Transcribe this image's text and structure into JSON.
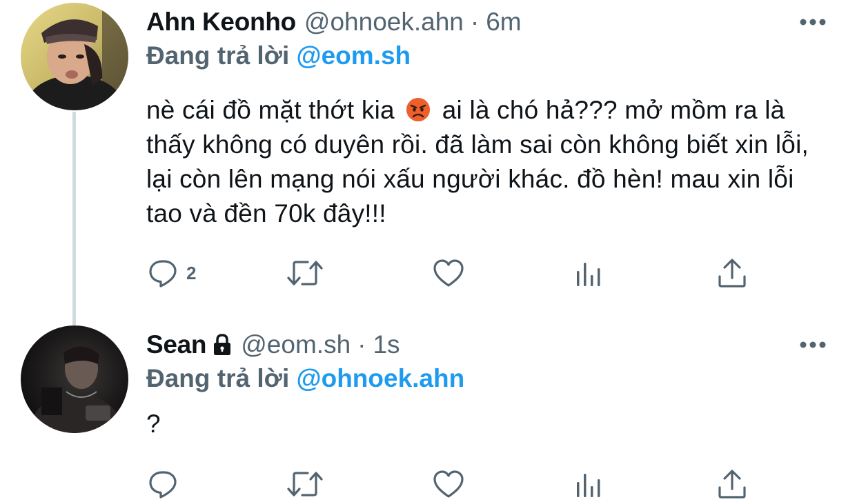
{
  "thread": [
    {
      "display_name": "Ahn Keonho",
      "handle": "@ohnoek.ahn",
      "separator": "·",
      "time": "6m",
      "reply_prefix": "Đang trả lời",
      "reply_mention": "@eom.sh",
      "text_part1": "nè cái đồ mặt thớt kia",
      "emoji": "pouting-face",
      "text_part2": "ai là chó hả??? mở mồm ra là thấy không có duyên rồi. đã làm sai còn không biết xin lỗi, lại còn lên mạng nói xấu người khác. đồ hèn! mau xin lỗi tao và đền 70k đây!!!",
      "reply_count": "2",
      "locked": false
    },
    {
      "display_name": "Sean",
      "handle": "@eom.sh",
      "separator": "·",
      "time": "1s",
      "reply_prefix": "Đang trả lời",
      "reply_mention": "@ohnoek.ahn",
      "text": "?",
      "reply_count": "",
      "locked": true
    }
  ],
  "colors": {
    "text": "#0f1419",
    "secondary": "#536471",
    "accent": "#1d9bf0",
    "thread_line": "#cfd9de"
  },
  "icons": [
    "reply-icon",
    "retweet-icon",
    "like-icon",
    "views-icon",
    "share-icon",
    "more-icon",
    "lock-icon"
  ]
}
